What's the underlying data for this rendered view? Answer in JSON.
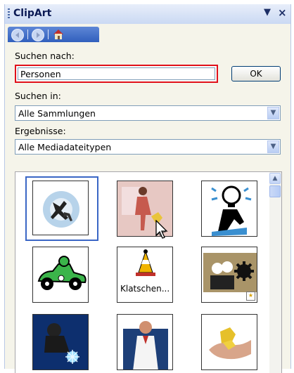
{
  "panel": {
    "title": "ClipArt",
    "dropdown_glyph": "▼",
    "close_glyph": "×"
  },
  "nav": {
    "back_icon": "back-arrow-icon",
    "forward_icon": "forward-arrow-icon",
    "home_icon": "home-icon"
  },
  "search": {
    "label": "Suchen nach:",
    "value": "Personen",
    "ok_label": "OK"
  },
  "search_in": {
    "label": "Suchen in:",
    "value": "Alle Sammlungen"
  },
  "results_type": {
    "label": "Ergebnisse:",
    "value": "Alle Mediadateitypen"
  },
  "clips": [
    {
      "name": "runners-gears"
    },
    {
      "name": "woman-walking"
    },
    {
      "name": "lightbulb-thinker"
    },
    {
      "name": "race-car-driver"
    },
    {
      "name": "traffic-cone-figure",
      "caption": "Klatschen..."
    },
    {
      "name": "people-with-gears"
    },
    {
      "name": "welder"
    },
    {
      "name": "doctor"
    },
    {
      "name": "hands-puzzle"
    }
  ],
  "colors": {
    "highlight_border": "#e0101a",
    "selection_border": "#3a66c5",
    "nav_bar": "#315fbd"
  }
}
